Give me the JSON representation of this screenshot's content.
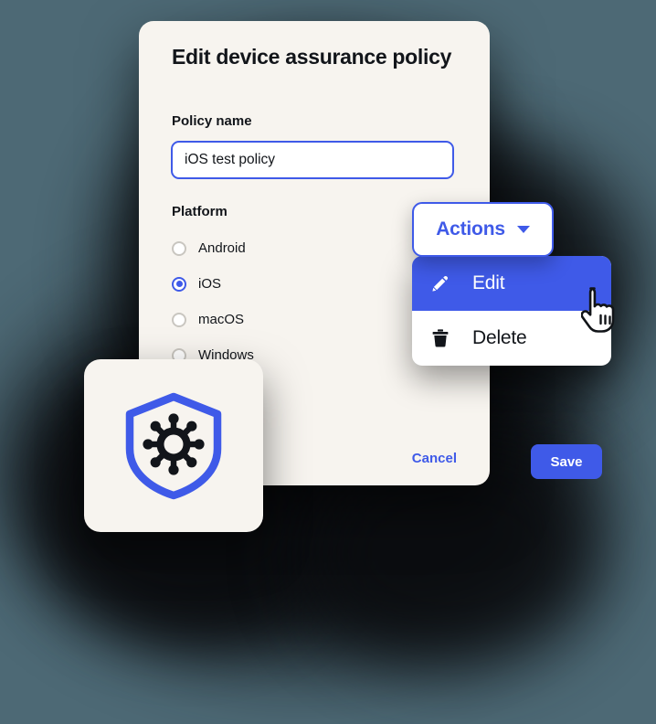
{
  "theme": {
    "page_background": "#4d6975",
    "card_background": "#f7f4ef",
    "accent_blue": "#3f5ae8",
    "text_dark": "#12151a",
    "input_background": "#ffffff",
    "radio_unselected_border": "#c9c6c0"
  },
  "modal": {
    "title": "Edit device assurance policy",
    "policy_name": {
      "label": "Policy name",
      "value": "iOS test policy",
      "placeholder": "Policy name"
    },
    "platform": {
      "label": "Platform",
      "selected": "iOS",
      "options": [
        {
          "label": "Android",
          "selected": false
        },
        {
          "label": "iOS",
          "selected": true
        },
        {
          "label": "macOS",
          "selected": false
        },
        {
          "label": "Windows",
          "selected": false
        }
      ]
    },
    "footer": {
      "cancel_label": "Cancel",
      "save_label": "Save"
    }
  },
  "actions": {
    "button_label": "Actions",
    "caret_icon": "chevron-down-icon",
    "menu": [
      {
        "label": "Edit",
        "icon": "pencil-icon",
        "highlighted": true
      },
      {
        "label": "Delete",
        "icon": "trash-icon",
        "highlighted": false
      }
    ]
  },
  "icon_card": {
    "icon": "shield-device-assurance-icon",
    "shield_color": "#3f5ae8",
    "hub_color": "#12151a"
  },
  "cursor": {
    "icon": "pointing-hand-cursor"
  }
}
